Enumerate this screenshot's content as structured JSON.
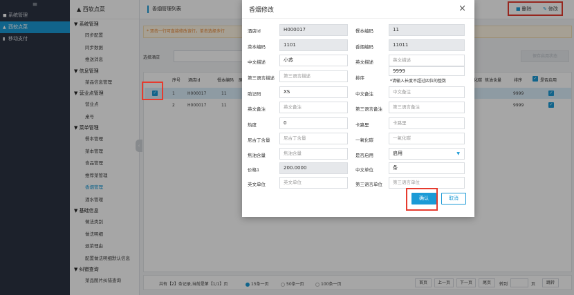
{
  "nav": {
    "toggle": "≡",
    "items": [
      {
        "label": "系统管理",
        "icon": "grid-icon"
      },
      {
        "label": "西软点菜",
        "icon": "triangle-icon"
      },
      {
        "label": "移动支付",
        "icon": "phone-icon"
      }
    ]
  },
  "menu": {
    "title": "西软点菜",
    "sections": {
      "system": "系统管理",
      "system_items": [
        "同步配置",
        "同步数据",
        "推送消息"
      ],
      "info": "信息管理",
      "info_items": [
        "菜品信息管理"
      ],
      "business": "营业点管理",
      "business_items": [
        "营业点",
        "桌号"
      ],
      "dishes": "菜单管理",
      "dishes_items": [
        "餐本管理",
        "菜本管理",
        "食品管理",
        "推荐菜管理",
        "香烟管理",
        "酒水管理"
      ],
      "basic": "基础信息",
      "basic_items": [
        "做法类别",
        "做法明细",
        "退菜理由",
        "配置做法明细默认信息"
      ],
      "query": "纠错查询",
      "query_items": [
        "菜品图片纠错查询"
      ]
    }
  },
  "header": {
    "title": "香烟管理列表",
    "delete": "删除",
    "edit": "修改"
  },
  "notice": "* 双击一行可直接修改该行，单击选择多行",
  "filter": {
    "label": "选择酒店",
    "save": "保存启用状态"
  },
  "grid": {
    "cols": {
      "seq": "序号",
      "hotel": "酒店id",
      "code": "餐本编码",
      "cn": "原",
      "mm": "化碳",
      "oil": "焦油含量",
      "sort": "排序",
      "enabled": "是否启用"
    },
    "rows": [
      {
        "seq": "1",
        "hotel": "H000017",
        "code": "11",
        "sort": "9999"
      },
      {
        "seq": "2",
        "hotel": "H000017",
        "code": "11",
        "sort": "9999"
      }
    ]
  },
  "pager": {
    "summary": "共有【2】条记录,当前是第【1/1】页",
    "opt15": "15条一页",
    "opt50": "50条一页",
    "opt100": "100条一页",
    "first": "首页",
    "prev": "上一页",
    "next": "下一页",
    "last": "尾页",
    "goto": "转到",
    "page": "页",
    "jump": "跳转"
  },
  "modal": {
    "title": "香烟修改",
    "close": "×",
    "fields": {
      "hotel_id_label": "酒店id",
      "hotel_id": "H000017",
      "menu_code_label": "餐本编码",
      "menu_code": "11",
      "dish_code_label": "菜本编码",
      "dish_code": "1101",
      "cig_code_label": "香烟编码",
      "cig_code": "11011",
      "cn_desc_label": "中文描述",
      "cn_desc": "小苏",
      "en_desc_label": "英文描述",
      "en_desc_ph": "英文描述",
      "third_desc_label": "第三语言描述",
      "third_desc_ph": "第三语言描述",
      "sort_label": "排序",
      "sort": "9999",
      "sort_hint": "*请输入长度不超过四位的整数",
      "mnemonic_label": "助记码",
      "mnemonic": "XS",
      "cn_note_label": "中文备注",
      "cn_note_ph": "中文备注",
      "en_note_label": "英文备注",
      "en_note_ph": "英文备注",
      "third_note_label": "第三语言备注",
      "third_note_ph": "第三语言备注",
      "heat_label": "热度",
      "heat": "0",
      "card_label": "卡路里",
      "card_ph": "卡路里",
      "nicotine_label": "尼古丁含量",
      "nicotine_ph": "尼古丁含量",
      "co_label": "一氧化碳",
      "co_ph": "一氧化碳",
      "tar_label": "焦油含量",
      "tar_ph": "焦油含量",
      "enabled_label": "是否启用",
      "enabled": "启用",
      "price_label": "价格1",
      "price": "200.0000",
      "cn_unit_label": "中文单位",
      "cn_unit": "条",
      "en_unit_label": "英文单位",
      "en_unit_ph": "英文单位",
      "third_unit_label": "第三语言单位",
      "third_unit_ph": "第三语言单位"
    },
    "ok": "确认",
    "cancel": "取消"
  },
  "colors": {
    "accent": "#1b9ad6",
    "highlight": "#e63b2e",
    "nav_bg": "#2c3342"
  }
}
